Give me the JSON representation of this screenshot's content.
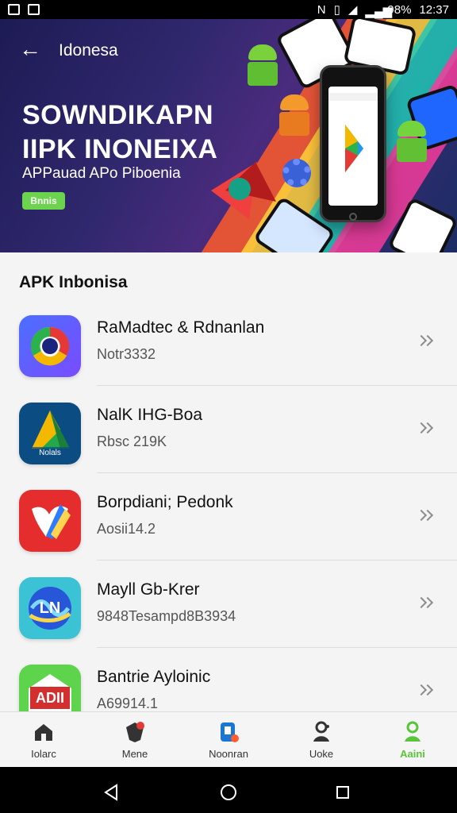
{
  "status": {
    "battery": "98%",
    "time": "12:37"
  },
  "header": {
    "back_label": "←",
    "title": "Idonesa"
  },
  "hero": {
    "headline_line1": "SOWNDIKAPN",
    "headline_line2": "IIPK INONEIXA",
    "subtitle": "APPauad APo Piboenia",
    "badge": "Bnnis",
    "colors": {
      "background_start": "#1d1b54",
      "background_end": "#1b2c63"
    }
  },
  "section": {
    "title": "APK Inbonisa"
  },
  "apps": [
    {
      "name": "RaMadtec & Rdnanlan",
      "meta": "Notr3332",
      "icon_name": "chrome-icon",
      "icon_colors": [
        "#4b6fff",
        "#7a4bff",
        "#ffffff",
        "#e53935",
        "#1a237e"
      ]
    },
    {
      "name": "NalK IHG-Boa",
      "meta": "Rbsc 219K",
      "icon_name": "triangle-logo-icon",
      "icon_colors": [
        "#0b4d82",
        "#24a84a",
        "#f5b800",
        "#ffffff"
      ]
    },
    {
      "name": "Borpdiani; Pedonk",
      "meta": "Aosii14.2",
      "icon_name": "red-logo-icon",
      "icon_colors": [
        "#e52d2d",
        "#ffffff",
        "#ffd54f",
        "#2b7cff"
      ]
    },
    {
      "name": "Mayll Gb-Krer",
      "meta": "9848Tesampd8B3934",
      "icon_name": "globe-icon",
      "icon_colors": [
        "#3bc2d4",
        "#2856d9",
        "#ffffff",
        "#f7d64a"
      ]
    },
    {
      "name": "Bantrie Ayloinic",
      "meta": "A69914.1",
      "icon_name": "adi-icon",
      "icon_colors": [
        "#5ed44c",
        "#ffffff",
        "#d32f2f"
      ]
    }
  ],
  "bottom_nav": [
    {
      "label": "Iolarc",
      "icon_name": "home-icon",
      "active": false
    },
    {
      "label": "Mene",
      "icon_name": "shield-icon",
      "active": false
    },
    {
      "label": "Noonran",
      "icon_name": "document-icon",
      "active": false
    },
    {
      "label": "Uoke",
      "icon_name": "person-add-icon",
      "active": false
    },
    {
      "label": "Aaini",
      "icon_name": "person-icon",
      "active": true
    }
  ],
  "system_nav": {
    "back": "back-icon",
    "home": "home-circle-icon",
    "recents": "recents-icon"
  }
}
